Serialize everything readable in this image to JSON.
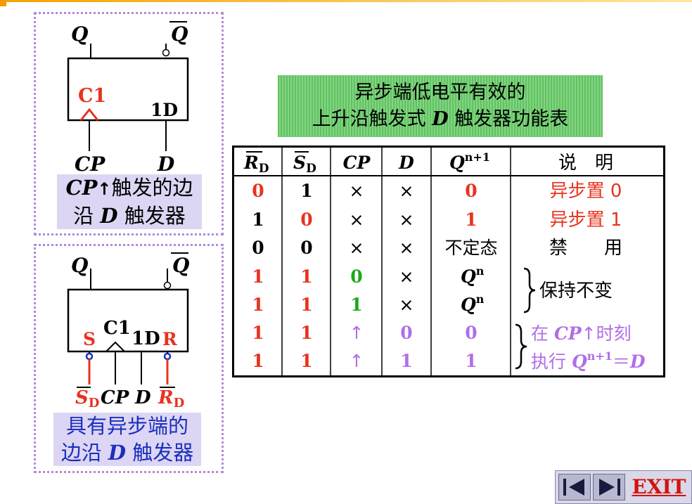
{
  "panel1": {
    "label_q": "Q",
    "label_qbar": "Q",
    "label_c1": "C1",
    "label_1d": "1D",
    "label_cp": "CP",
    "label_d": "D",
    "caption_line1_a": "CP",
    "caption_line1_b": "触发的边",
    "caption_line2_a": "沿 ",
    "caption_line2_b": "D",
    "caption_line2_c": " 触发器"
  },
  "panel2": {
    "label_q": "Q",
    "label_qbar": "Q",
    "label_c1": "C1",
    "label_1d": "1D",
    "label_s": "S",
    "label_r": "R",
    "label_sd": "S",
    "label_sd_sub": "D",
    "label_cp": "CP",
    "label_d": "D",
    "label_rd": "R",
    "label_rd_sub": "D",
    "caption_line1": "具有异步端的",
    "caption_line2_a": "边沿 ",
    "caption_line2_b": "D",
    "caption_line2_c": " 触发器"
  },
  "title": {
    "line1": "异步端低电平有效的",
    "line2_a": "上升沿触发式 ",
    "line2_b": "D",
    "line2_c": " 触发器功能表"
  },
  "table": {
    "headers": {
      "rd": "R",
      "rd_sub": "D",
      "sd": "S",
      "sd_sub": "D",
      "cp": "CP",
      "d": "D",
      "q": "Q",
      "q_sup": "n+1",
      "desc": "说　明"
    },
    "rows": [
      {
        "rd": "0",
        "sd": "1",
        "cp": "×",
        "d": "×",
        "q": "0"
      },
      {
        "rd": "1",
        "sd": "0",
        "cp": "×",
        "d": "×",
        "q": "1"
      },
      {
        "rd": "0",
        "sd": "0",
        "cp": "×",
        "d": "×",
        "q": "不定态"
      },
      {
        "rd": "1",
        "sd": "1",
        "cp": "0",
        "d": "×",
        "q": "Q",
        "q_sup": "n"
      },
      {
        "rd": "1",
        "sd": "1",
        "cp": "1",
        "d": "×",
        "q": "Q",
        "q_sup": "n"
      },
      {
        "rd": "1",
        "sd": "1",
        "cp": "↑",
        "d": "0",
        "q": "0"
      },
      {
        "rd": "1",
        "sd": "1",
        "cp": "↑",
        "d": "1",
        "q": "1"
      }
    ],
    "desc": {
      "set0": "异步置 0",
      "set1": "异步置 1",
      "forbid": "禁　　用",
      "hold": "保持不变",
      "exec_a": "在 ",
      "exec_b": "CP",
      "exec_c": "↑时刻",
      "exec_d": "执行 ",
      "exec_e": "Q",
      "exec_sup": "n+1",
      "exec_f": "＝",
      "exec_g": "D"
    }
  },
  "nav": {
    "exit_label": "EXIT"
  },
  "colors": {
    "red": "#e8321e",
    "green": "#1aa81a",
    "violet": "#b16ee8",
    "blue": "#1c2fbd",
    "panel_border": "#b48ad8"
  }
}
